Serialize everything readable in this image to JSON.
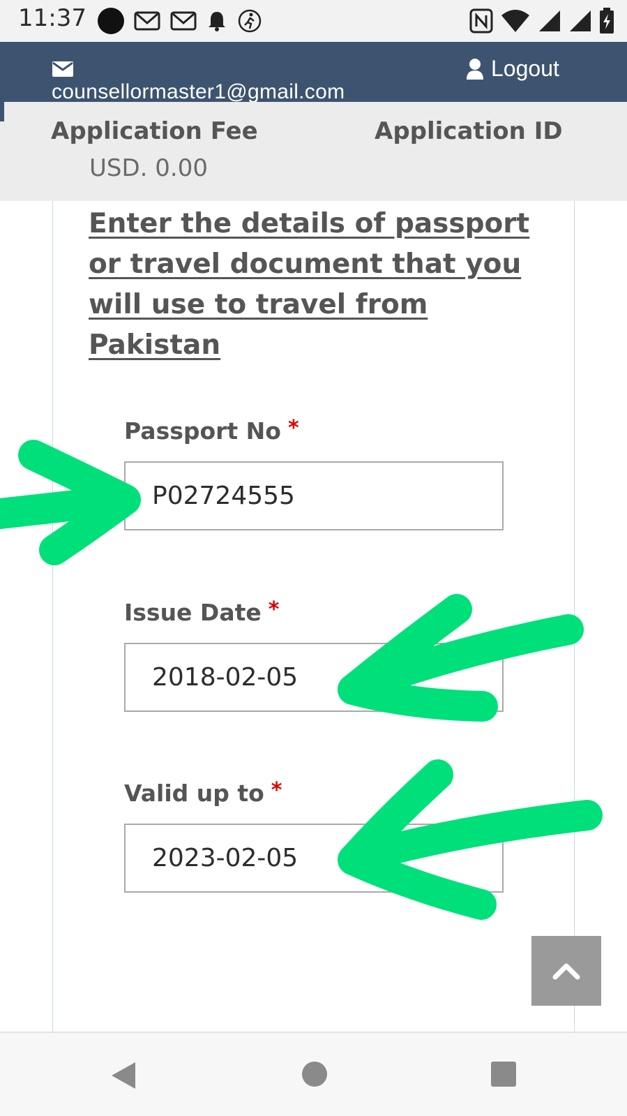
{
  "status_bar": {
    "time": "11:37",
    "left_icons": [
      "black-circle-icon",
      "gmail-icon",
      "gmail-icon",
      "notification-bell-icon",
      "activity-icon"
    ],
    "right_icons": [
      "nfc-icon",
      "wifi-icon",
      "signal-icon",
      "signal-icon",
      "battery-charging-icon"
    ]
  },
  "header": {
    "email": "counsellormaster1@gmail.com",
    "logout_label": "Logout",
    "background_color": "#3d5470"
  },
  "fee_bar": {
    "fee_label": "Application Fee",
    "fee_value": "USD. 0.00",
    "app_id_label": "Application ID"
  },
  "form": {
    "heading": "Enter the details of passport or travel document that you will use to travel from Pakistan",
    "required_marker": "*",
    "fields": [
      {
        "label": "Passport No",
        "value": "P02724555"
      },
      {
        "label": "Issue Date",
        "value": "2018-02-05"
      },
      {
        "label": "Valid up to",
        "value": "2023-02-05"
      }
    ]
  },
  "annotation_color": "#00e07a",
  "scroll_top_icon": "chevron-up-icon",
  "nav_bar": {
    "icons": [
      "back-icon",
      "home-icon",
      "recents-icon"
    ]
  }
}
